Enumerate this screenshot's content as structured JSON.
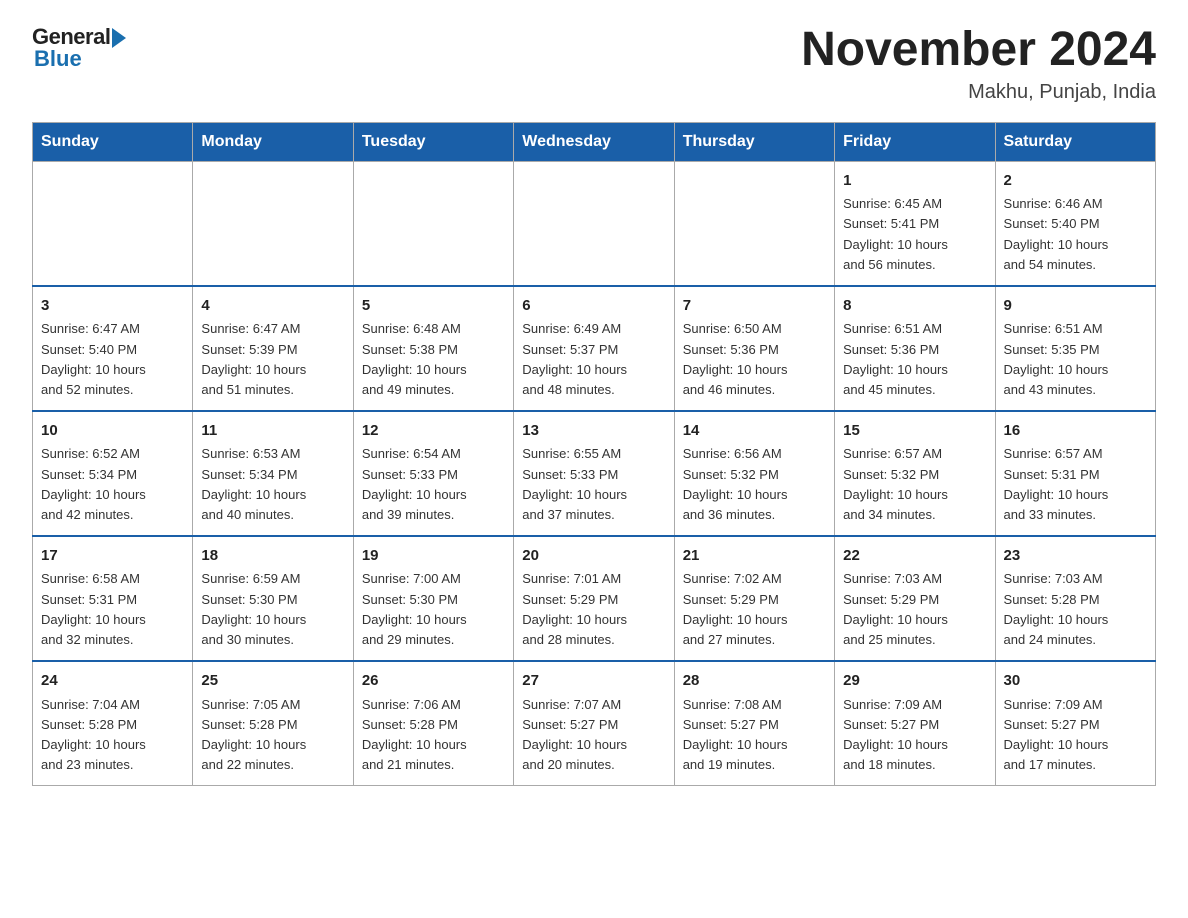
{
  "header": {
    "logo": {
      "general": "General",
      "blue": "Blue"
    },
    "title": "November 2024",
    "location": "Makhu, Punjab, India"
  },
  "weekdays": [
    "Sunday",
    "Monday",
    "Tuesday",
    "Wednesday",
    "Thursday",
    "Friday",
    "Saturday"
  ],
  "weeks": [
    [
      {
        "day": "",
        "info": ""
      },
      {
        "day": "",
        "info": ""
      },
      {
        "day": "",
        "info": ""
      },
      {
        "day": "",
        "info": ""
      },
      {
        "day": "",
        "info": ""
      },
      {
        "day": "1",
        "info": "Sunrise: 6:45 AM\nSunset: 5:41 PM\nDaylight: 10 hours\nand 56 minutes."
      },
      {
        "day": "2",
        "info": "Sunrise: 6:46 AM\nSunset: 5:40 PM\nDaylight: 10 hours\nand 54 minutes."
      }
    ],
    [
      {
        "day": "3",
        "info": "Sunrise: 6:47 AM\nSunset: 5:40 PM\nDaylight: 10 hours\nand 52 minutes."
      },
      {
        "day": "4",
        "info": "Sunrise: 6:47 AM\nSunset: 5:39 PM\nDaylight: 10 hours\nand 51 minutes."
      },
      {
        "day": "5",
        "info": "Sunrise: 6:48 AM\nSunset: 5:38 PM\nDaylight: 10 hours\nand 49 minutes."
      },
      {
        "day": "6",
        "info": "Sunrise: 6:49 AM\nSunset: 5:37 PM\nDaylight: 10 hours\nand 48 minutes."
      },
      {
        "day": "7",
        "info": "Sunrise: 6:50 AM\nSunset: 5:36 PM\nDaylight: 10 hours\nand 46 minutes."
      },
      {
        "day": "8",
        "info": "Sunrise: 6:51 AM\nSunset: 5:36 PM\nDaylight: 10 hours\nand 45 minutes."
      },
      {
        "day": "9",
        "info": "Sunrise: 6:51 AM\nSunset: 5:35 PM\nDaylight: 10 hours\nand 43 minutes."
      }
    ],
    [
      {
        "day": "10",
        "info": "Sunrise: 6:52 AM\nSunset: 5:34 PM\nDaylight: 10 hours\nand 42 minutes."
      },
      {
        "day": "11",
        "info": "Sunrise: 6:53 AM\nSunset: 5:34 PM\nDaylight: 10 hours\nand 40 minutes."
      },
      {
        "day": "12",
        "info": "Sunrise: 6:54 AM\nSunset: 5:33 PM\nDaylight: 10 hours\nand 39 minutes."
      },
      {
        "day": "13",
        "info": "Sunrise: 6:55 AM\nSunset: 5:33 PM\nDaylight: 10 hours\nand 37 minutes."
      },
      {
        "day": "14",
        "info": "Sunrise: 6:56 AM\nSunset: 5:32 PM\nDaylight: 10 hours\nand 36 minutes."
      },
      {
        "day": "15",
        "info": "Sunrise: 6:57 AM\nSunset: 5:32 PM\nDaylight: 10 hours\nand 34 minutes."
      },
      {
        "day": "16",
        "info": "Sunrise: 6:57 AM\nSunset: 5:31 PM\nDaylight: 10 hours\nand 33 minutes."
      }
    ],
    [
      {
        "day": "17",
        "info": "Sunrise: 6:58 AM\nSunset: 5:31 PM\nDaylight: 10 hours\nand 32 minutes."
      },
      {
        "day": "18",
        "info": "Sunrise: 6:59 AM\nSunset: 5:30 PM\nDaylight: 10 hours\nand 30 minutes."
      },
      {
        "day": "19",
        "info": "Sunrise: 7:00 AM\nSunset: 5:30 PM\nDaylight: 10 hours\nand 29 minutes."
      },
      {
        "day": "20",
        "info": "Sunrise: 7:01 AM\nSunset: 5:29 PM\nDaylight: 10 hours\nand 28 minutes."
      },
      {
        "day": "21",
        "info": "Sunrise: 7:02 AM\nSunset: 5:29 PM\nDaylight: 10 hours\nand 27 minutes."
      },
      {
        "day": "22",
        "info": "Sunrise: 7:03 AM\nSunset: 5:29 PM\nDaylight: 10 hours\nand 25 minutes."
      },
      {
        "day": "23",
        "info": "Sunrise: 7:03 AM\nSunset: 5:28 PM\nDaylight: 10 hours\nand 24 minutes."
      }
    ],
    [
      {
        "day": "24",
        "info": "Sunrise: 7:04 AM\nSunset: 5:28 PM\nDaylight: 10 hours\nand 23 minutes."
      },
      {
        "day": "25",
        "info": "Sunrise: 7:05 AM\nSunset: 5:28 PM\nDaylight: 10 hours\nand 22 minutes."
      },
      {
        "day": "26",
        "info": "Sunrise: 7:06 AM\nSunset: 5:28 PM\nDaylight: 10 hours\nand 21 minutes."
      },
      {
        "day": "27",
        "info": "Sunrise: 7:07 AM\nSunset: 5:27 PM\nDaylight: 10 hours\nand 20 minutes."
      },
      {
        "day": "28",
        "info": "Sunrise: 7:08 AM\nSunset: 5:27 PM\nDaylight: 10 hours\nand 19 minutes."
      },
      {
        "day": "29",
        "info": "Sunrise: 7:09 AM\nSunset: 5:27 PM\nDaylight: 10 hours\nand 18 minutes."
      },
      {
        "day": "30",
        "info": "Sunrise: 7:09 AM\nSunset: 5:27 PM\nDaylight: 10 hours\nand 17 minutes."
      }
    ]
  ]
}
